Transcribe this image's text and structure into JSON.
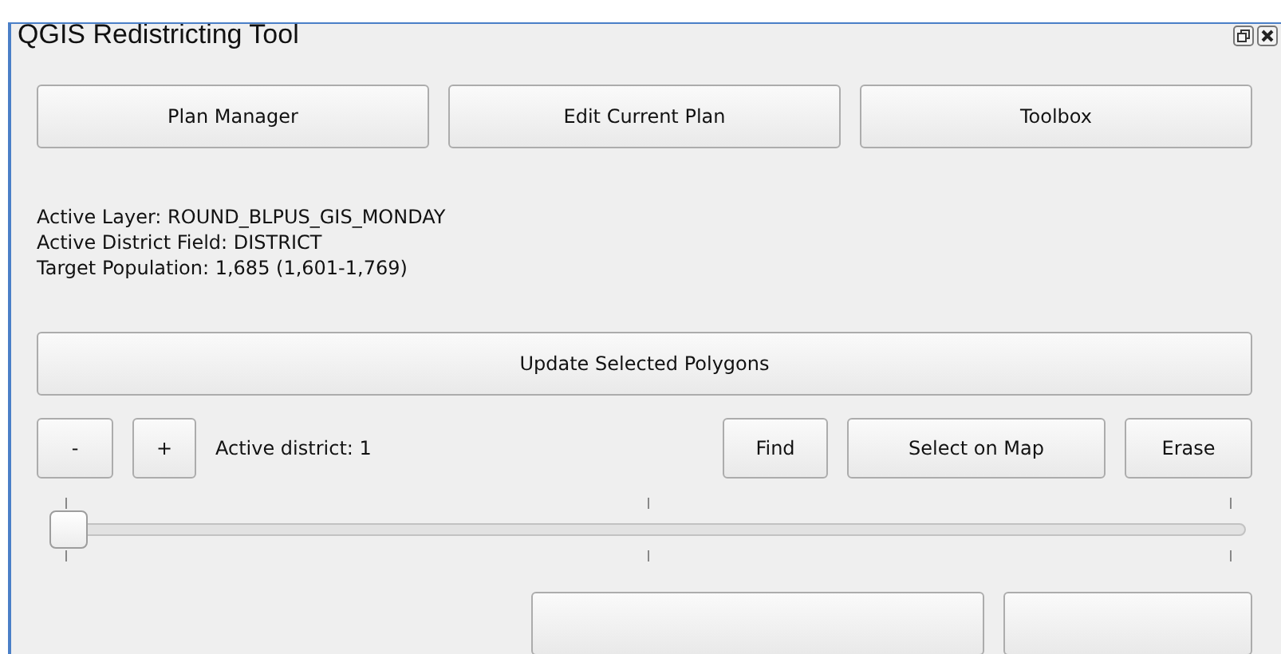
{
  "window": {
    "title": "QGIS Redistricting Tool"
  },
  "top_buttons": [
    "Plan Manager",
    "Edit Current Plan",
    "Toolbox"
  ],
  "info": [
    "Active Layer: ROUND_BLPUS_GIS_MONDAY",
    "Active District Field: DISTRICT",
    "Target Population: 1,685 (1,601-1,769)"
  ],
  "update_button": "Update Selected Polygons",
  "district_row": {
    "minus": "-",
    "plus": "+",
    "label": "Active district: 1",
    "buttons": [
      "Find",
      "Select on Map",
      "Erase"
    ]
  },
  "slider": {
    "level": 0
  }
}
